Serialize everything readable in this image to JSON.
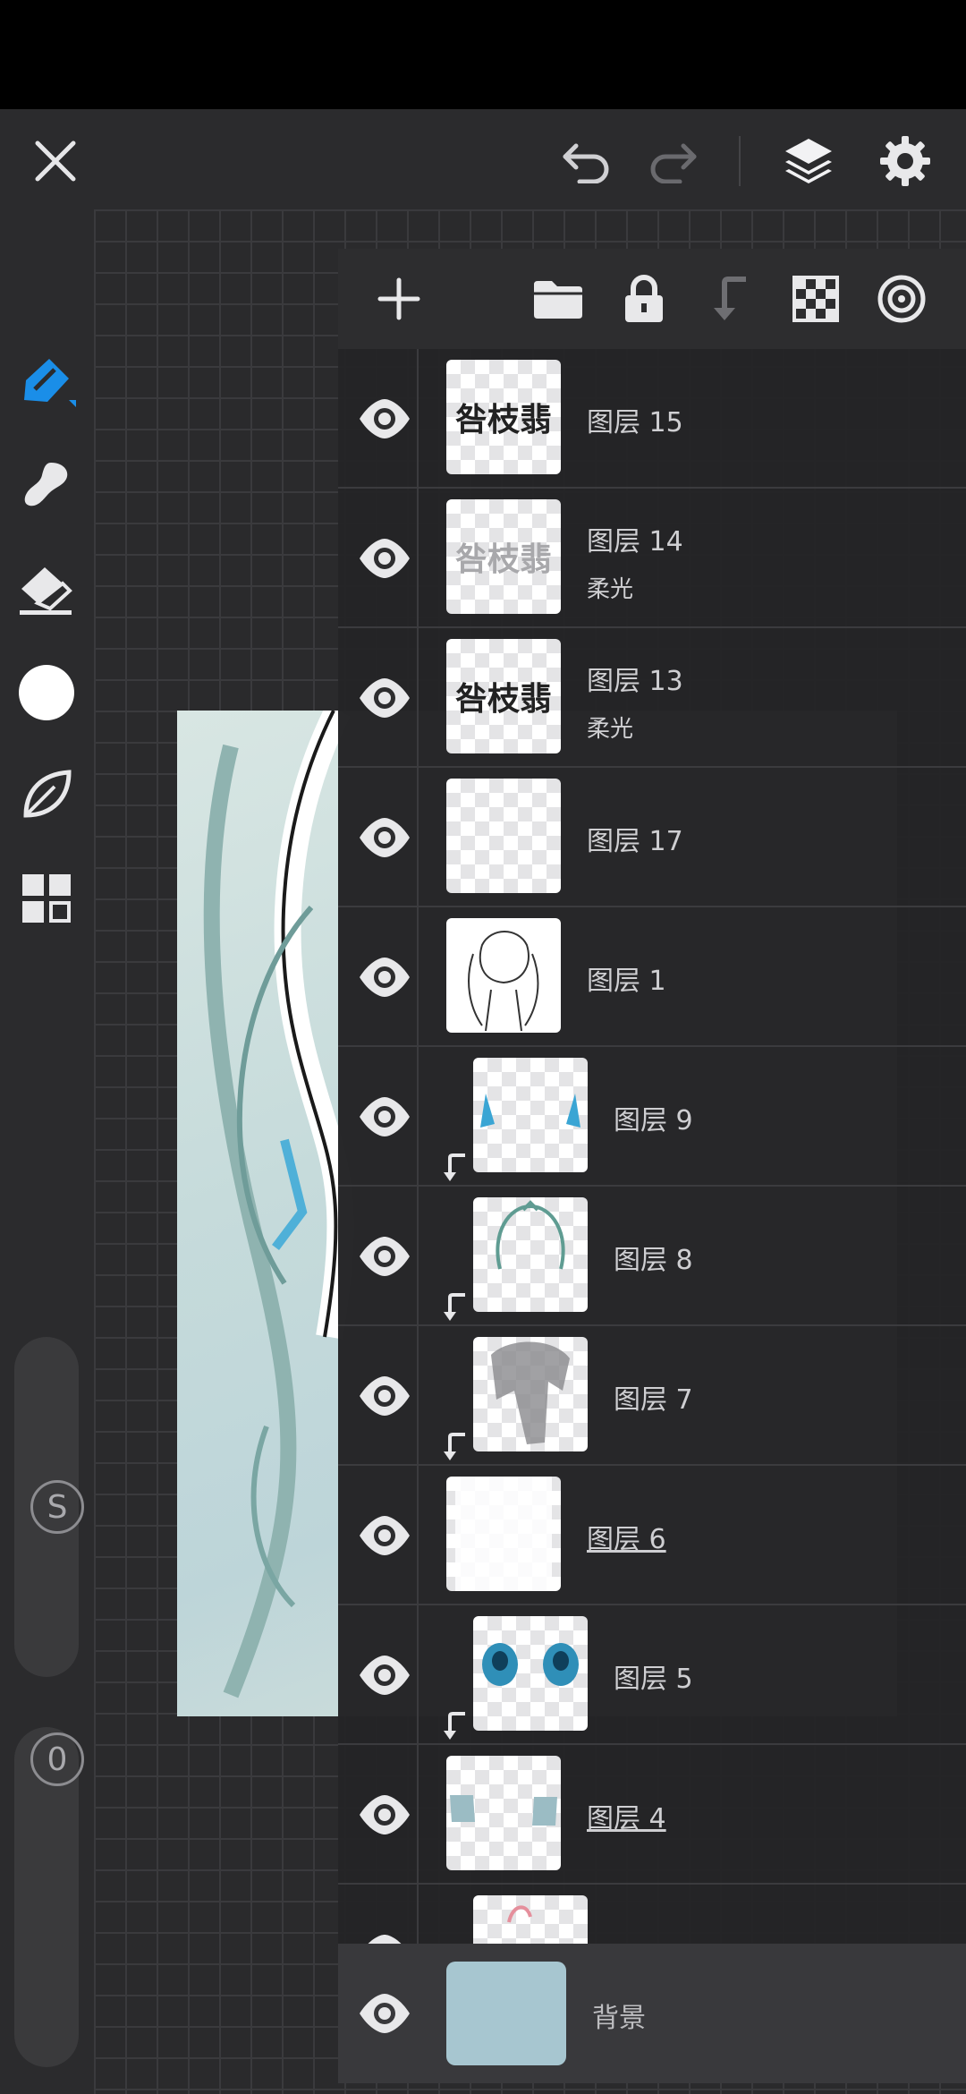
{
  "app": {
    "accent_color": "#1a8ee8",
    "toolbar_icons": [
      "close-icon",
      "undo-icon",
      "redo-icon",
      "layers-icon",
      "settings-icon"
    ],
    "tools": [
      "brush-icon",
      "smudge-icon",
      "eraser-icon",
      "color-icon",
      "leaf-icon",
      "grid-icon"
    ],
    "current_color": "#ffffff",
    "sliders": {
      "size_label": "S",
      "opacity_label": "0"
    }
  },
  "layer_panel": {
    "actions": [
      "add-layer-icon",
      "folder-icon",
      "lock-icon",
      "clip-down-icon",
      "transparency-icon",
      "target-icon"
    ],
    "layers": [
      {
        "name": "图层 15",
        "mode": "",
        "thumb_text": "咎枝翡",
        "clipped": false,
        "underlined": false
      },
      {
        "name": "图层 14",
        "mode": "柔光",
        "thumb_text": "咎枝翡",
        "clipped": false,
        "underlined": false
      },
      {
        "name": "图层 13",
        "mode": "柔光",
        "thumb_text": "咎枝翡",
        "clipped": false,
        "underlined": false
      },
      {
        "name": "图层 17",
        "mode": "",
        "thumb_text": "",
        "clipped": false,
        "underlined": false
      },
      {
        "name": "图层 1",
        "mode": "",
        "thumb_text": "",
        "clipped": false,
        "underlined": false
      },
      {
        "name": "图层 9",
        "mode": "",
        "thumb_text": "",
        "clipped": true,
        "underlined": false
      },
      {
        "name": "图层 8",
        "mode": "",
        "thumb_text": "",
        "clipped": true,
        "underlined": false
      },
      {
        "name": "图层 7",
        "mode": "",
        "thumb_text": "",
        "clipped": true,
        "underlined": false
      },
      {
        "name": "图层 6",
        "mode": "",
        "thumb_text": "",
        "clipped": false,
        "underlined": true
      },
      {
        "name": "图层 5",
        "mode": "",
        "thumb_text": "",
        "clipped": true,
        "underlined": false
      },
      {
        "name": "图层 4",
        "mode": "",
        "thumb_text": "",
        "clipped": false,
        "underlined": true
      },
      {
        "name": "",
        "mode": "",
        "thumb_text": "",
        "clipped": true,
        "underlined": false
      }
    ],
    "background": {
      "name": "背景",
      "color": "#a7c6d0"
    }
  }
}
